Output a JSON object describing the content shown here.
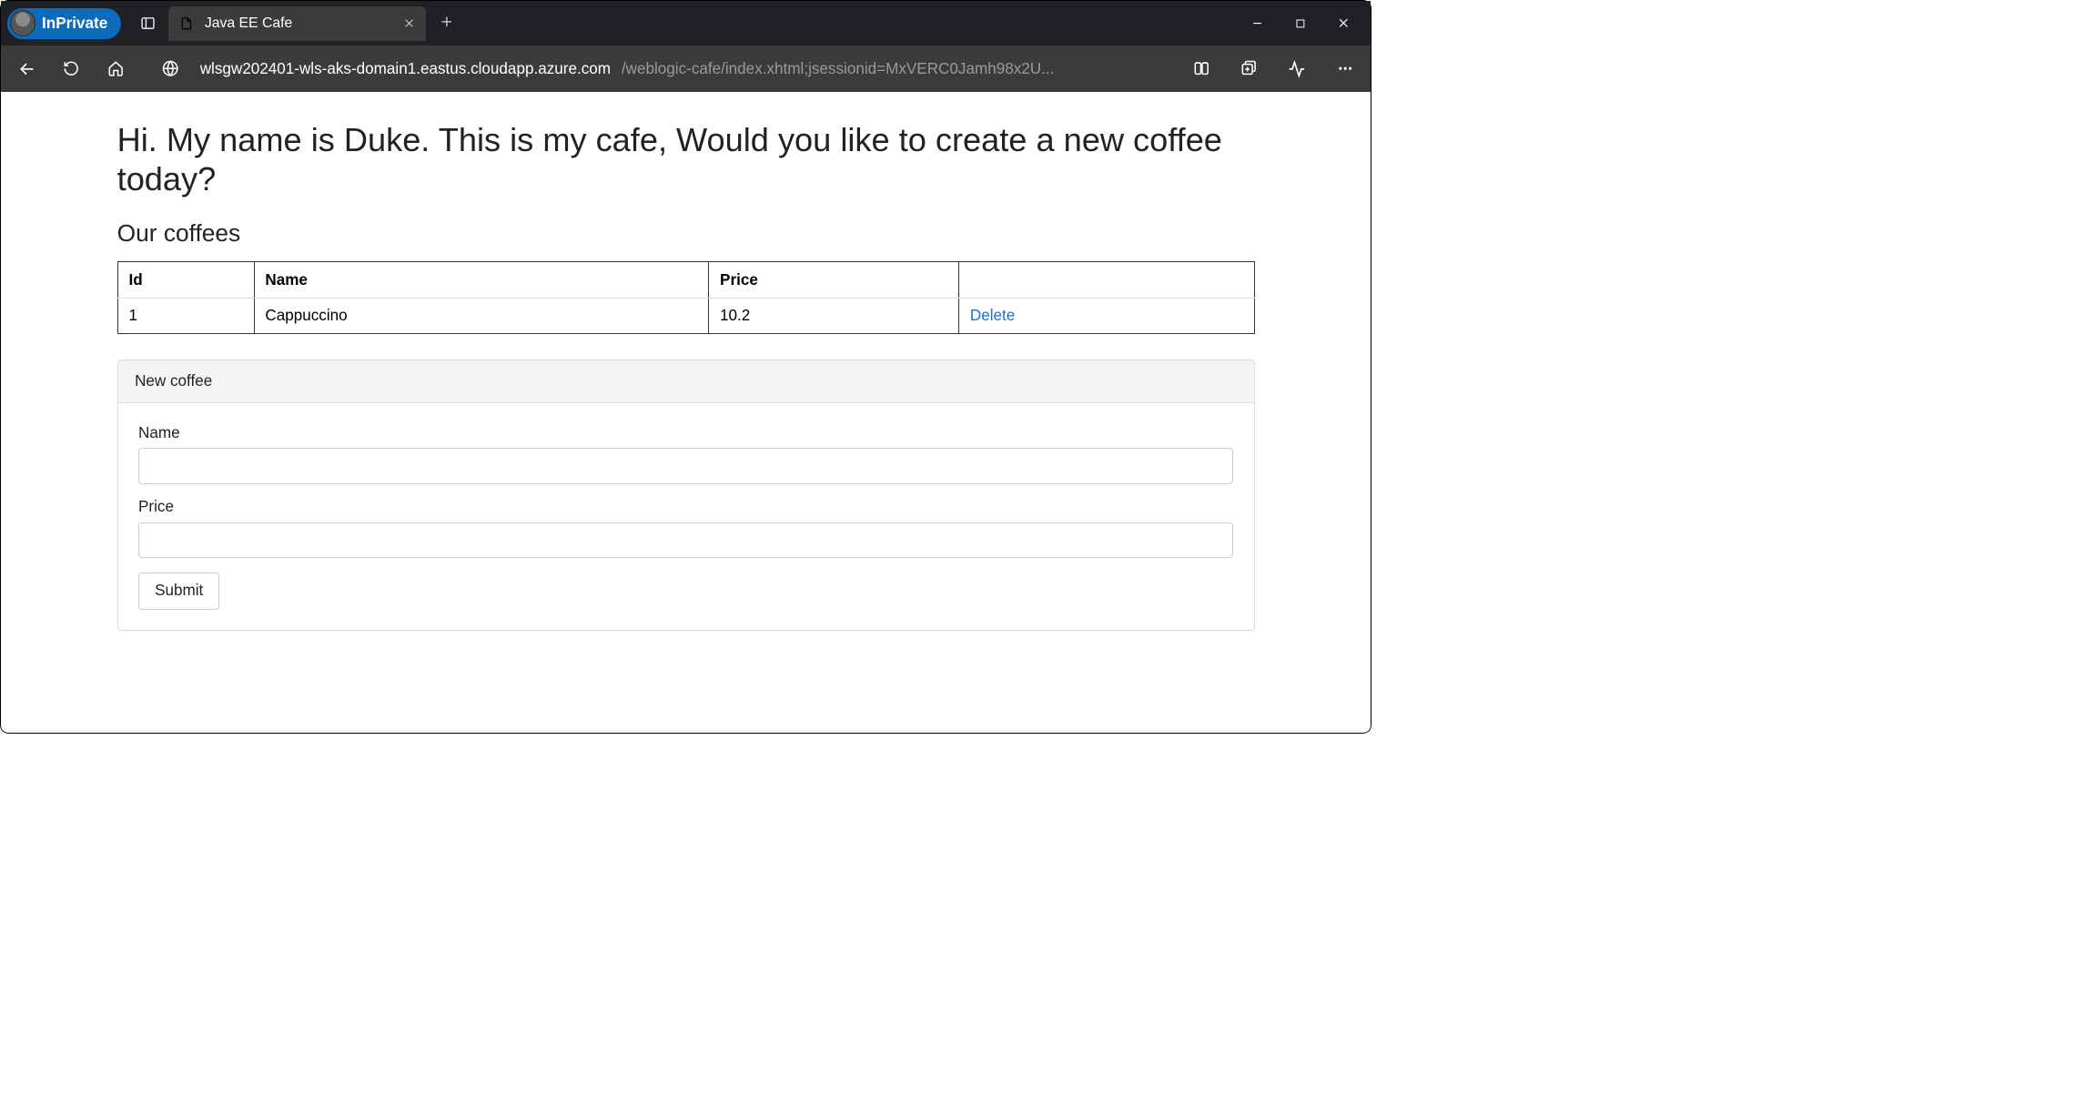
{
  "browser": {
    "inprivate_label": "InPrivate",
    "tab_title": "Java EE Cafe",
    "url_host": "wlsgw202401-wls-aks-domain1.eastus.cloudapp.azure.com",
    "url_path": "/weblogic-cafe/index.xhtml;jsessionid=MxVERC0Jamh98x2U..."
  },
  "page": {
    "title": "Hi. My name is Duke. This is my cafe, Would you like to create a new coffee today?",
    "subhead": "Our coffees",
    "table": {
      "headers": {
        "id": "Id",
        "name": "Name",
        "price": "Price",
        "actions": ""
      },
      "rows": [
        {
          "id": "1",
          "name": "Cappuccino",
          "price": "10.2",
          "action": "Delete"
        }
      ]
    },
    "form": {
      "panel_title": "New coffee",
      "name_label": "Name",
      "name_value": "",
      "price_label": "Price",
      "price_value": "",
      "submit_label": "Submit"
    }
  }
}
